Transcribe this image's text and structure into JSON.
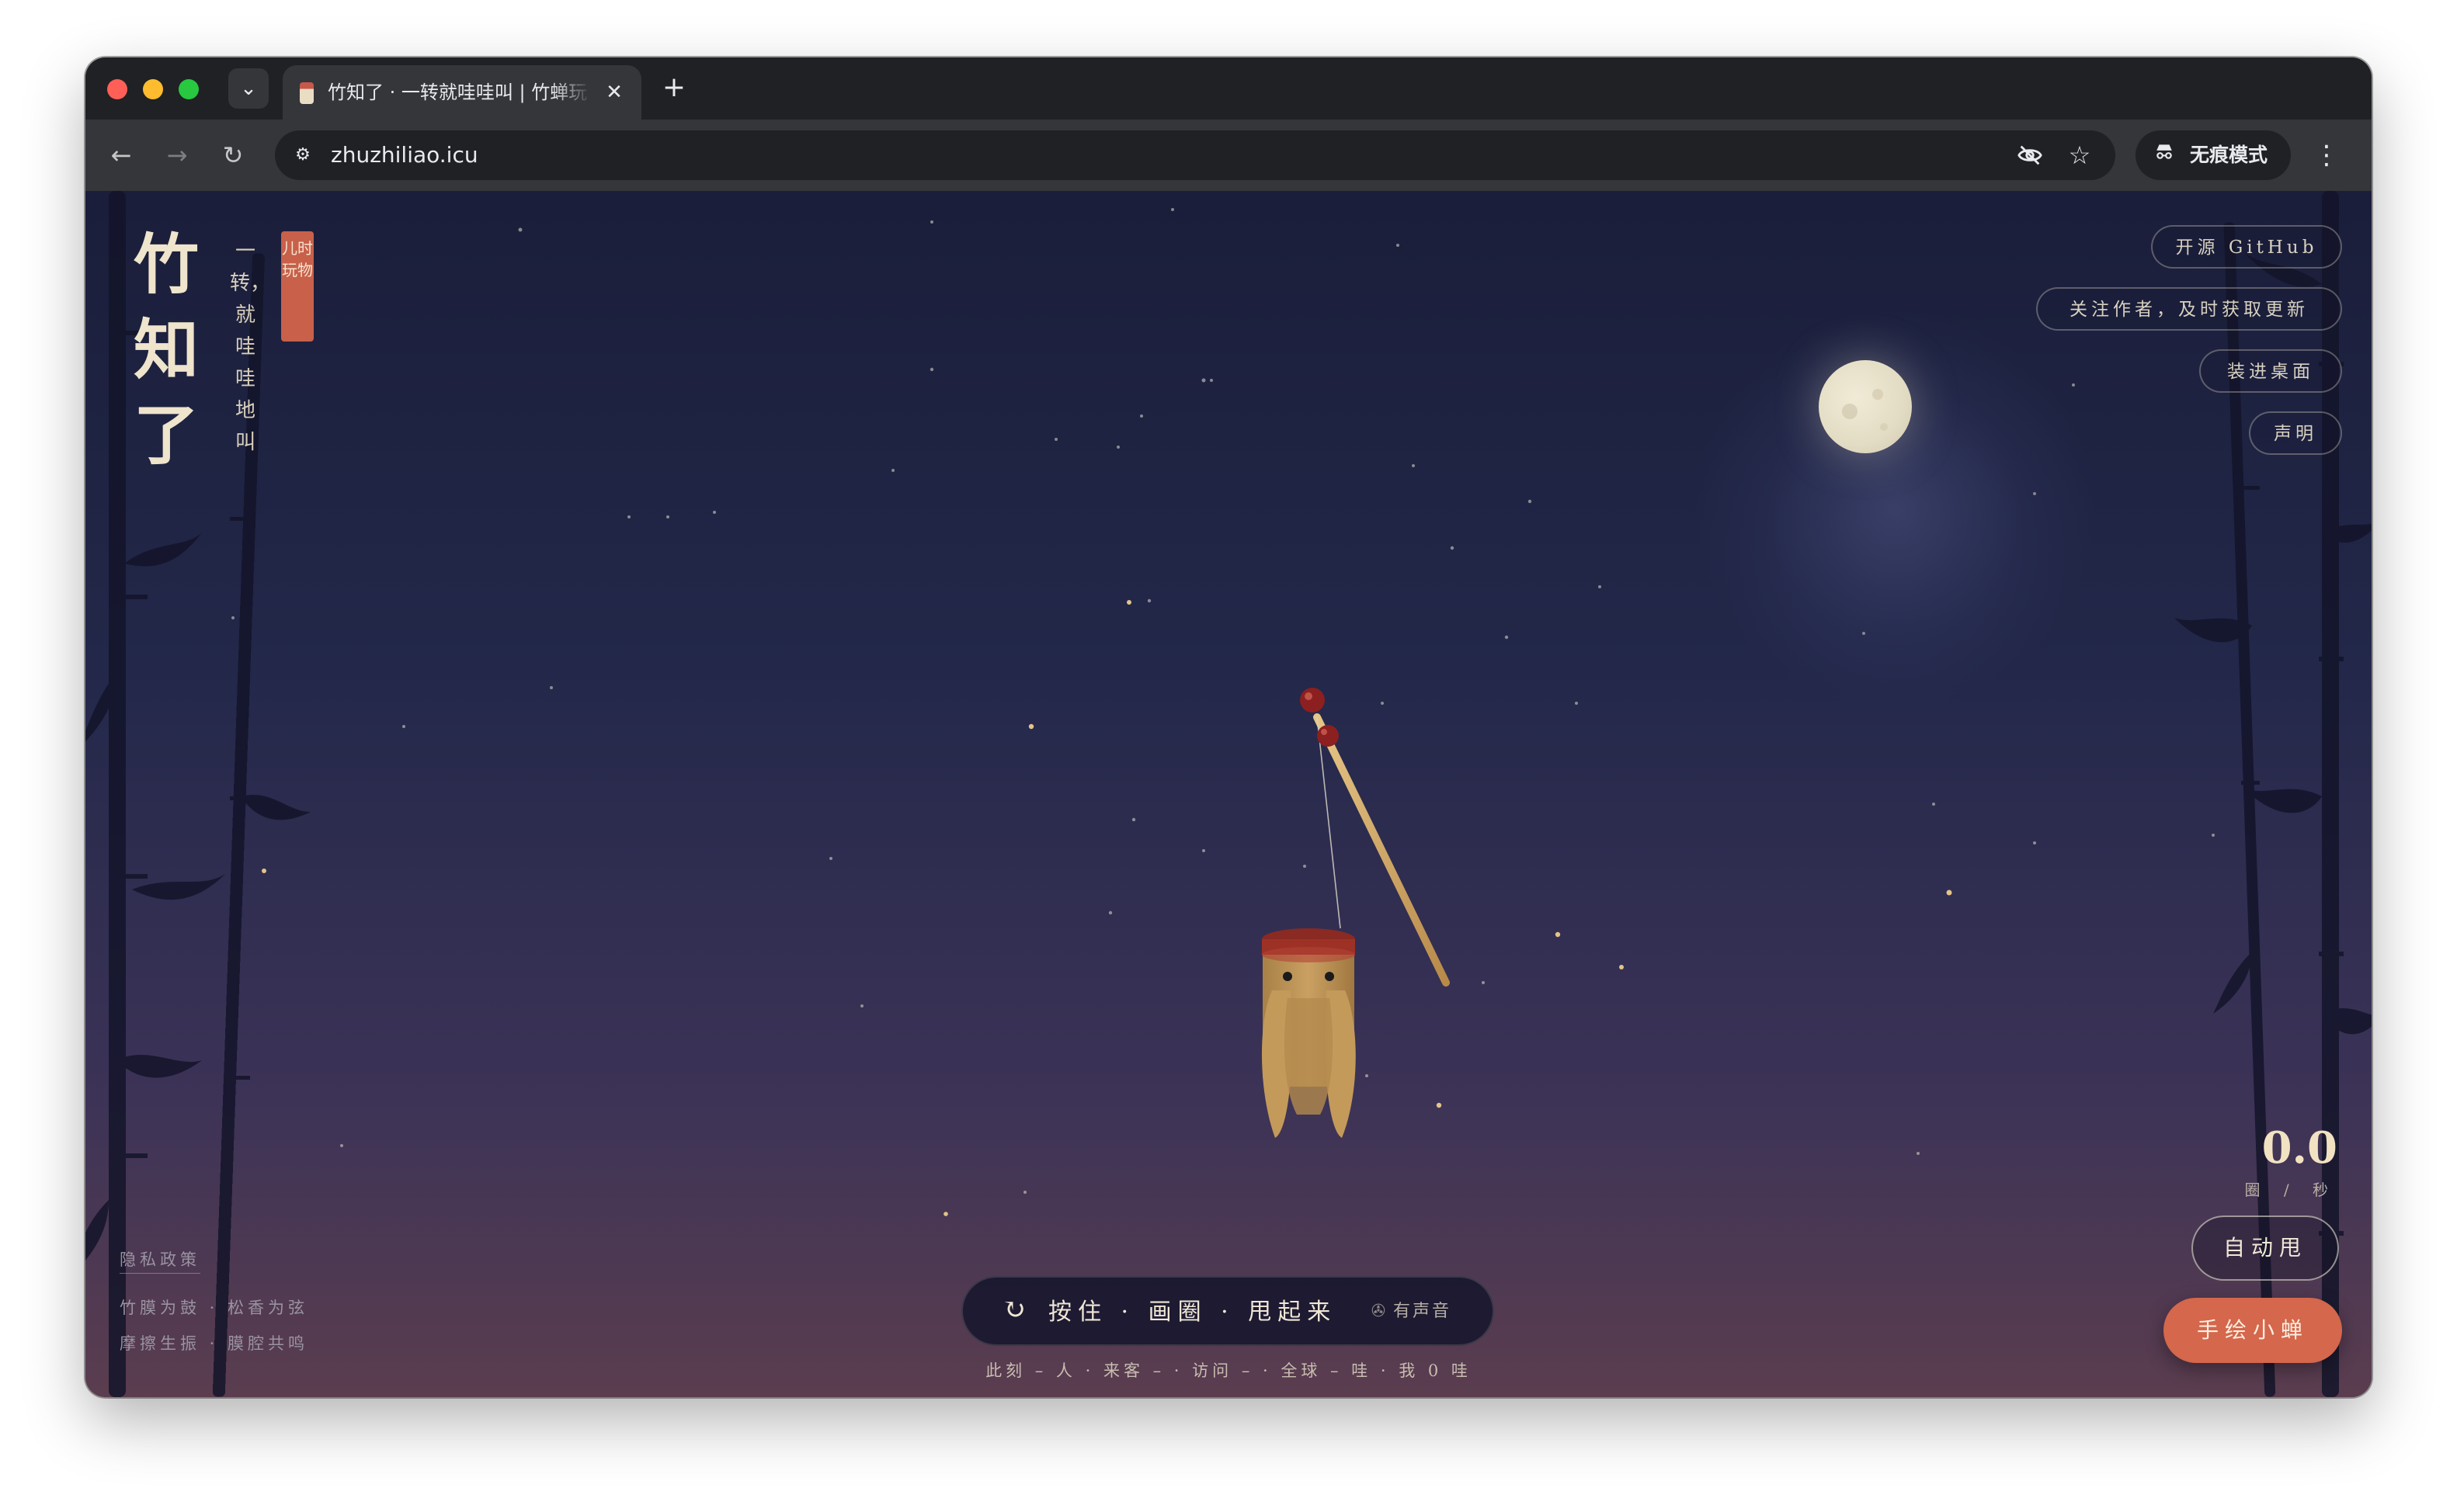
{
  "browser": {
    "tab_title": "竹知了 · 一转就哇哇叫 | 竹蝉玩",
    "tab_close_glyph": "✕",
    "new_tab_glyph": "+",
    "tab_search_glyph": "⌄",
    "url": "zhuzhiliao.icu",
    "incognito_label": "无痕模式",
    "icons": [
      "back-arrow-icon",
      "forward-arrow-icon",
      "reload-icon",
      "site-settings-icon",
      "eye-off-icon",
      "star-icon",
      "incognito-icon",
      "more-menu-icon"
    ]
  },
  "page": {
    "title_chars": [
      "竹",
      "知",
      "了"
    ],
    "subtitle": "一转，就哇哇地叫",
    "seal": "儿时玩物",
    "top_buttons": [
      "开源 GitHub",
      "关注作者，及时获取更新",
      "装进桌面",
      "声明"
    ],
    "control_bar": {
      "text": "按住 · 画圈 · 甩起来",
      "sound_label": "有声音"
    },
    "stats_line": "此刻 – 人 · 来客 – · 访问 – · 全球 – 哇 · 我 0 哇",
    "speed": {
      "value": "0.0",
      "unit": "圈 / 秒"
    },
    "auto_button": "自动甩",
    "draw_button": "手绘小蝉",
    "privacy_link": "隐私政策",
    "footer_lines": [
      "竹膜为鼓 · 松香为弦",
      "摩擦生振 · 膜腔共鸣"
    ]
  },
  "colors": {
    "sky_top": "#1a1e3a",
    "sky_bottom": "#5b3d4f",
    "accent_orange": "#d4674c",
    "moon": "#e8e1c8",
    "seal_red": "#c8604a",
    "bamboo_yellow": "#c99a55"
  }
}
